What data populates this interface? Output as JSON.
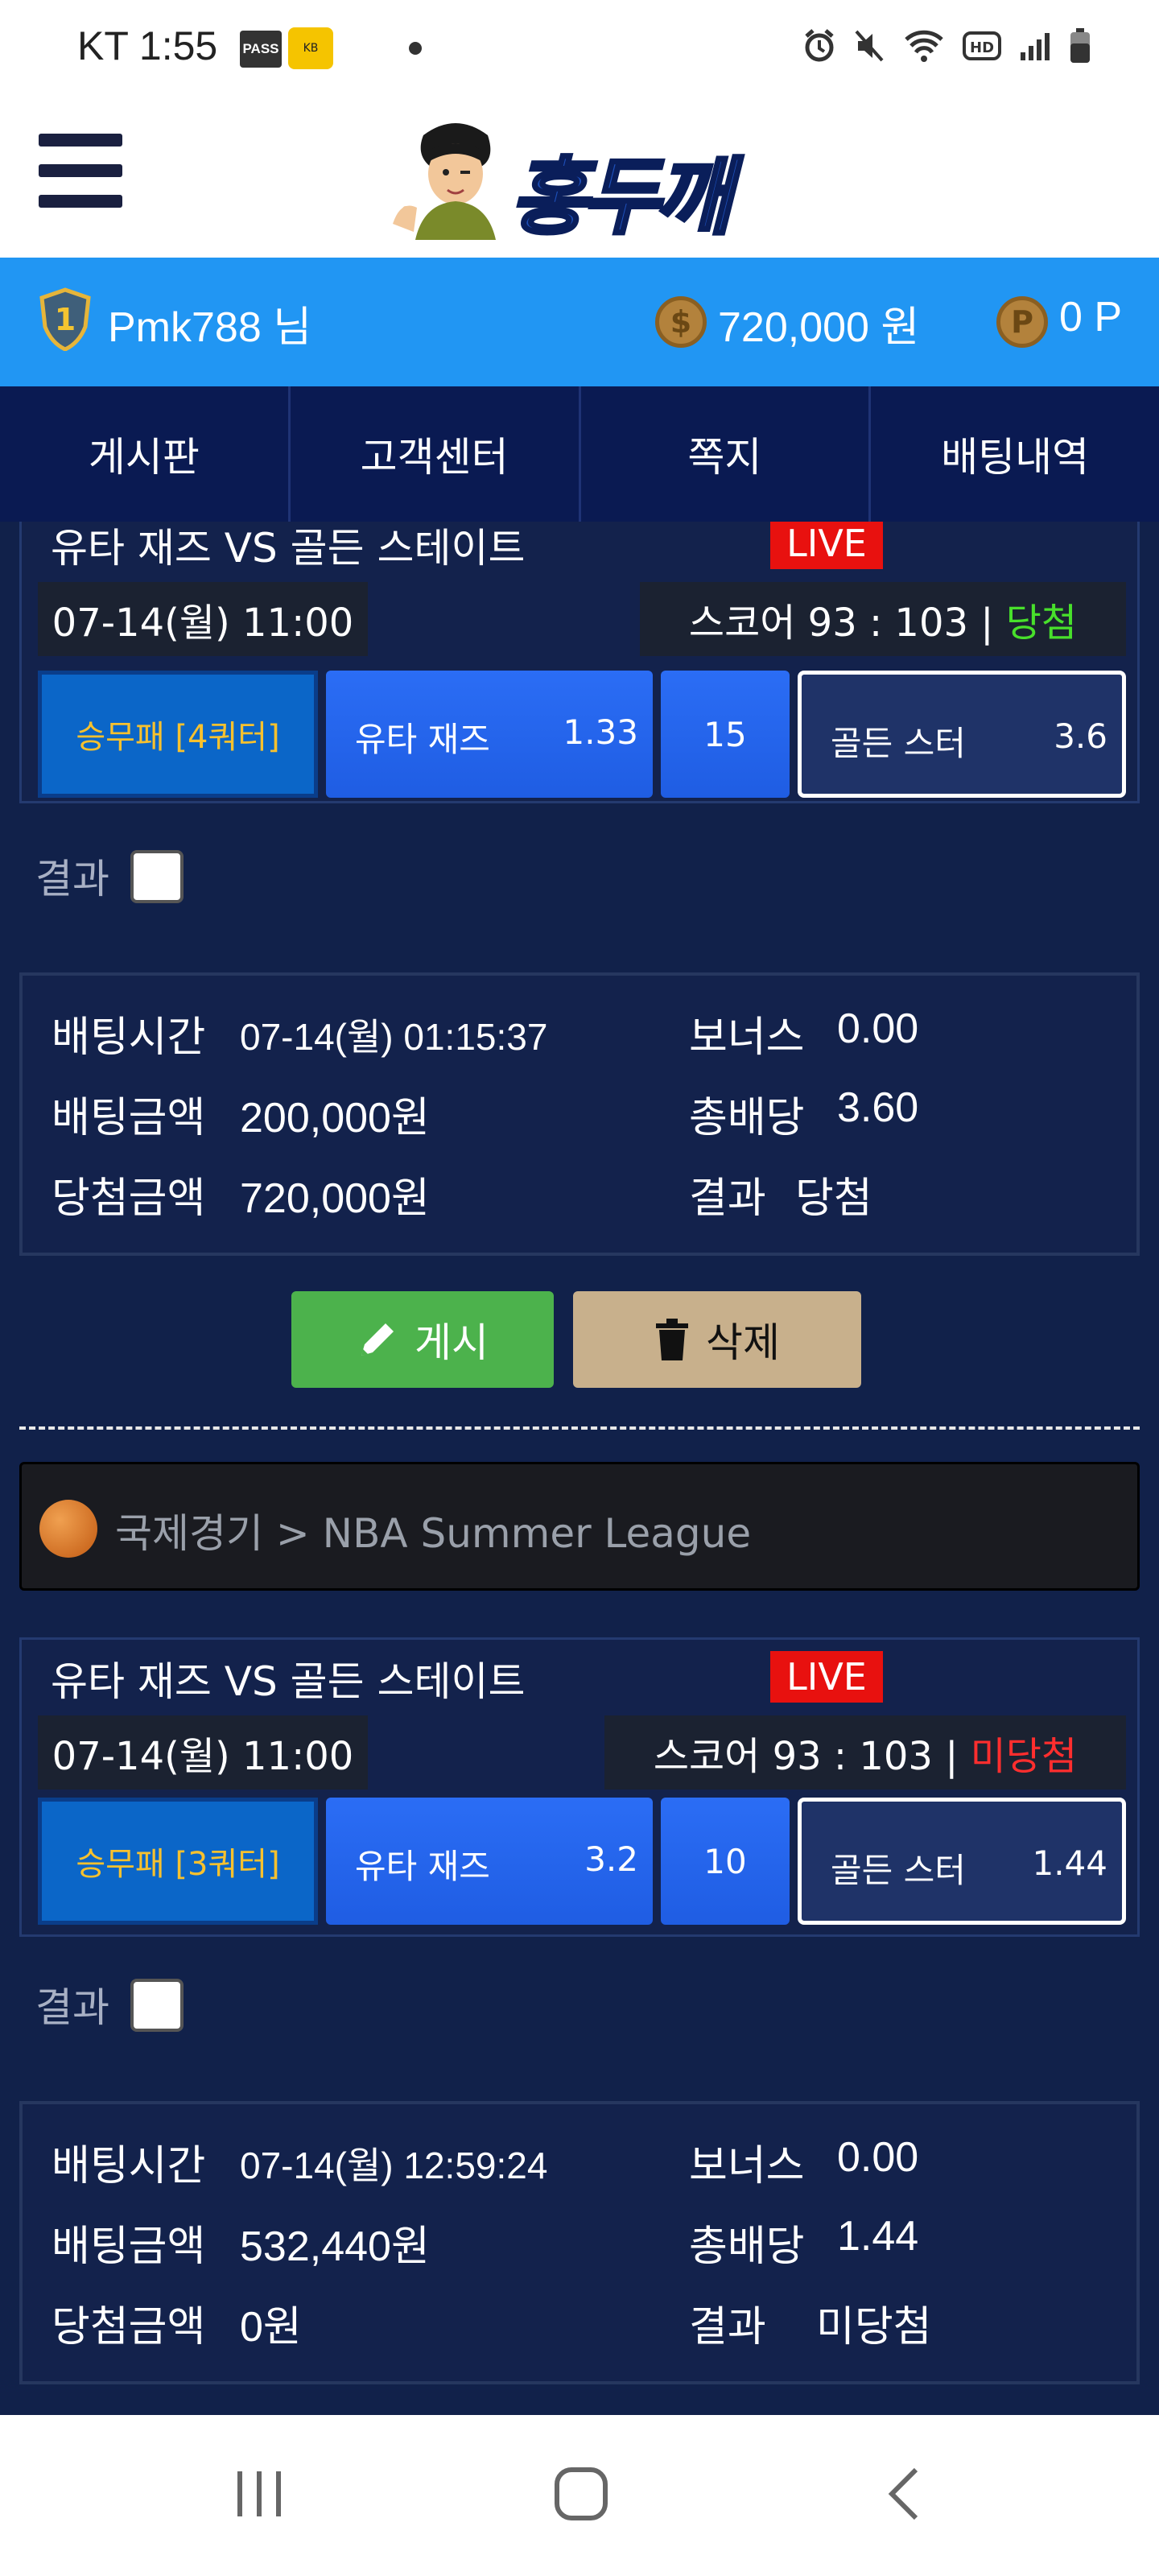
{
  "status_bar": {
    "time": "KT 1:55",
    "pass_badge": "PASS",
    "kb_badge": "KB"
  },
  "header": {
    "logo_text": "홍두깨"
  },
  "user_bar": {
    "level": "1",
    "username": "Pmk788 님",
    "money": "720,000 원",
    "points": "0 P"
  },
  "nav": {
    "items": [
      {
        "label": "게시판"
      },
      {
        "label": "고객센터"
      },
      {
        "label": "쪽지"
      },
      {
        "label": "배팅내역"
      }
    ]
  },
  "bets": [
    {
      "match": "유타 재즈 VS 골든 스테이트",
      "live": "LIVE",
      "date": "07-14(월) 11:00",
      "score_prefix": "스코어 93 : 103 |",
      "score_result": "당첨",
      "bet_type": "승무패 [4쿼터]",
      "home_team": "유타 재즈",
      "home_odds": "1.33",
      "draw_odds": "15",
      "away_team": "골든 스터",
      "away_odds": "3.6",
      "result_label": "결과",
      "details": {
        "bet_time_label": "배팅시간",
        "bet_time": "07-14(월) 01:15:37",
        "bonus_label": "보너스",
        "bonus": "0.00",
        "amount_label": "배팅금액",
        "amount": "200,000원",
        "total_odds_label": "총배당",
        "total_odds": "3.60",
        "win_amount_label": "당첨금액",
        "win_amount": "720,000원",
        "result_label": "결과",
        "result": "당첨"
      }
    },
    {
      "match": "유타 재즈 VS 골든 스테이트",
      "live": "LIVE",
      "date": "07-14(월) 11:00",
      "score_prefix": "스코어 93 : 103 |",
      "score_result": "미당첨",
      "bet_type": "승무패 [3쿼터]",
      "home_team": "유타 재즈",
      "home_odds": "3.2",
      "draw_odds": "10",
      "away_team": "골든 스터",
      "away_odds": "1.44",
      "result_label": "결과",
      "details": {
        "bet_time_label": "배팅시간",
        "bet_time": "07-14(월) 12:59:24",
        "bonus_label": "보너스",
        "bonus": "0.00",
        "amount_label": "배팅금액",
        "amount": "532,440원",
        "total_odds_label": "총배당",
        "total_odds": "1.44",
        "win_amount_label": "당첨금액",
        "win_amount": "0원",
        "result_label": "결과",
        "result": "미당첨"
      }
    }
  ],
  "actions": {
    "post_label": "게시",
    "delete_label": "삭제"
  },
  "league": {
    "text": "국제경기 > NBA Summer League"
  },
  "colors": {
    "background": "#11214a",
    "user_bar": "#2196f3",
    "nav": "#0a1a52",
    "win": "#48e02b",
    "lose": "#ff2e2e",
    "live": "#e8110f",
    "post_button": "#4cb24c",
    "delete_button": "#c8b08c"
  }
}
